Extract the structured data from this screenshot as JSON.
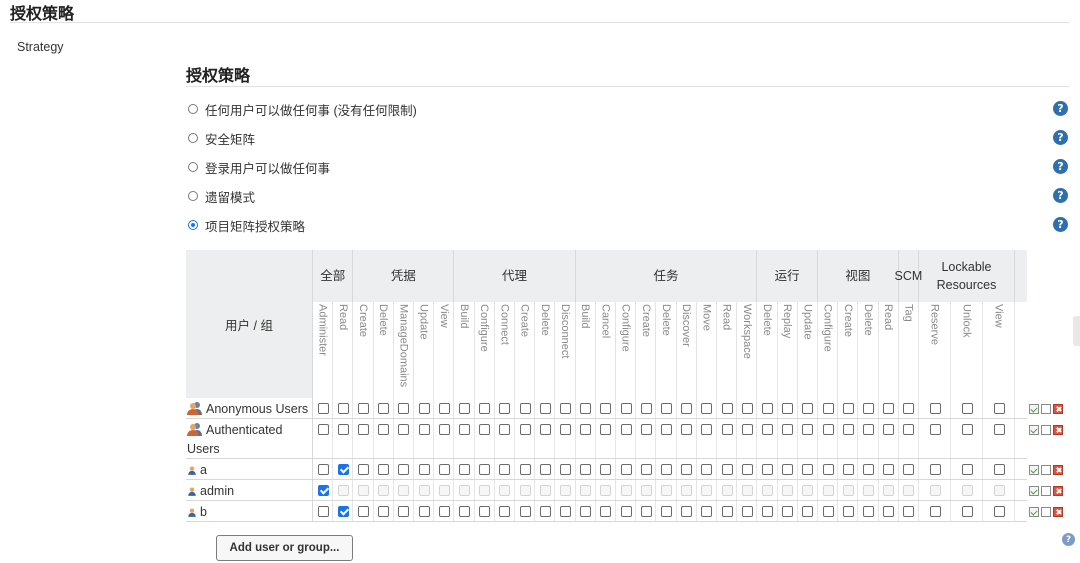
{
  "section": {
    "title": "授权策略",
    "strategy_label": "Strategy",
    "subtitle": "授权策略"
  },
  "options": [
    {
      "label": "任何用户可以做任何事 (没有任何限制)",
      "checked": false
    },
    {
      "label": "安全矩阵",
      "checked": false
    },
    {
      "label": "登录用户可以做任何事",
      "checked": false
    },
    {
      "label": "遗留模式",
      "checked": false
    },
    {
      "label": "项目矩阵授权策略",
      "checked": true
    }
  ],
  "help_glyph": "?",
  "matrix": {
    "user_header": "用户 / 组",
    "groups": [
      {
        "name": "全部",
        "perms": [
          "Administer",
          "Read"
        ]
      },
      {
        "name": "凭据",
        "perms": [
          "Create",
          "Delete",
          "ManageDomains",
          "Update",
          "View"
        ]
      },
      {
        "name": "代理",
        "perms": [
          "Build",
          "Configure",
          "Connect",
          "Create",
          "Delete",
          "Disconnect"
        ]
      },
      {
        "name": "任务",
        "perms": [
          "Build",
          "Cancel",
          "Configure",
          "Create",
          "Delete",
          "Discover",
          "Move",
          "Read",
          "Workspace"
        ]
      },
      {
        "name": "运行",
        "perms": [
          "Delete",
          "Replay",
          "Update"
        ]
      },
      {
        "name": "视图",
        "perms": [
          "Configure",
          "Create",
          "Delete",
          "Read"
        ]
      },
      {
        "name": "SCM",
        "perms": [
          "Tag"
        ]
      },
      {
        "name": "Lockable Resources",
        "perms": [
          "Reserve",
          "Unlock",
          "View"
        ]
      }
    ],
    "rows": [
      {
        "name": "Anonymous Users",
        "kind": "group",
        "checked": [],
        "disabled_all_but_first": false
      },
      {
        "name": "Authenticated Users",
        "kind": "group",
        "checked": [],
        "disabled_all_but_first": false
      },
      {
        "name": "a",
        "kind": "user",
        "checked": [
          1
        ],
        "disabled_all_but_first": false
      },
      {
        "name": "admin",
        "kind": "user",
        "checked": [
          0
        ],
        "disabled_all_but_first": true
      },
      {
        "name": "b",
        "kind": "user",
        "checked": [
          1
        ],
        "disabled_all_but_first": false
      }
    ]
  },
  "add_button": "Add user or group...",
  "colors": {
    "accent": "#1a73e8",
    "help": "#2f6fb0",
    "header_bg": "#eceeef",
    "delete": "#e0523c"
  }
}
